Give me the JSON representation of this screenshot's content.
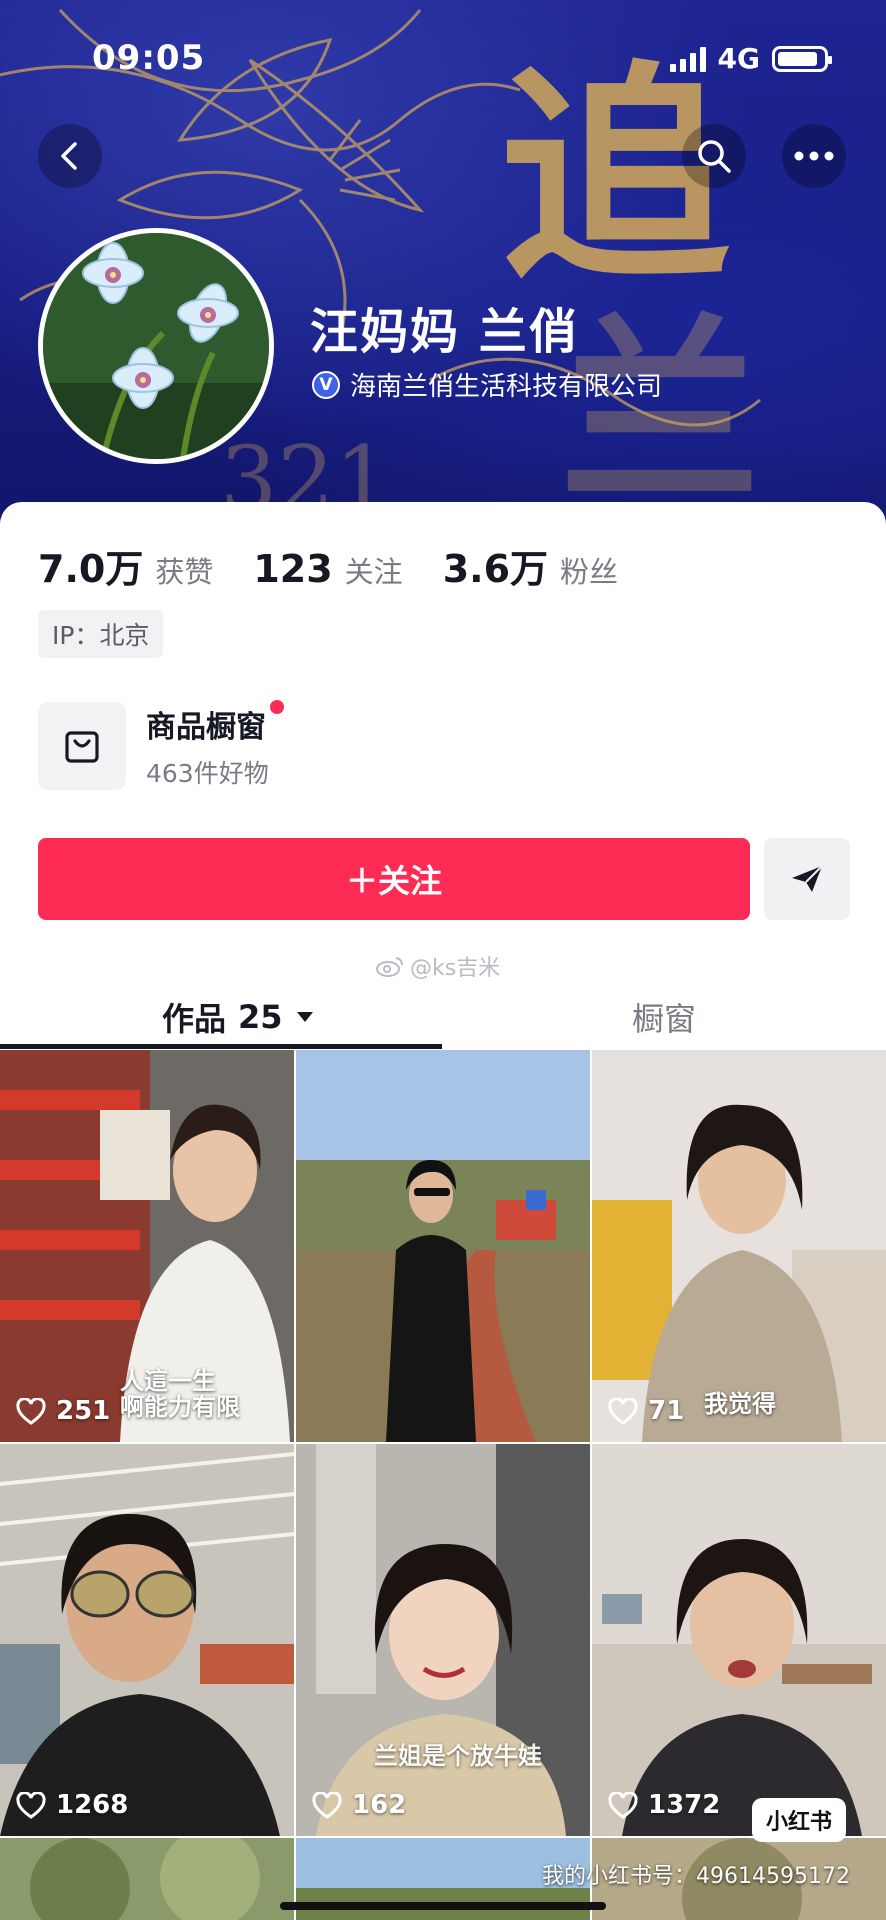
{
  "status_bar": {
    "time": "09:05",
    "network": "4G"
  },
  "banner": {
    "chars": [
      "追",
      "兰"
    ]
  },
  "profile": {
    "name": "汪妈妈 兰俏",
    "verified_badge": "V",
    "company": "海南兰俏生活科技有限公司"
  },
  "stats": [
    {
      "num": "7.0万",
      "label": "获赞"
    },
    {
      "num": "123",
      "label": "关注"
    },
    {
      "num": "3.6万",
      "label": "粉丝"
    }
  ],
  "ip_tag": "IP：北京",
  "shop": {
    "title": "商品橱窗",
    "subtitle": "463件好物"
  },
  "follow_button": "＋关注",
  "mid_watermark": "@ks吉米",
  "tabs": {
    "works_label": "作品",
    "works_count": "25",
    "shop_label": "橱窗"
  },
  "videos": [
    {
      "likes": "251",
      "caption": "人這一生\n啊能力有限"
    },
    {
      "likes": "",
      "caption": ""
    },
    {
      "likes": "71",
      "caption": "我觉得"
    },
    {
      "likes": "1268",
      "caption": ""
    },
    {
      "likes": "162",
      "caption": "兰姐是个放牛娃"
    },
    {
      "likes": "1372",
      "caption": ""
    }
  ],
  "overlay": {
    "xhs_badge": "小红书",
    "xhs_id": "我的小红书号：4961459517​2"
  },
  "colors": {
    "accent": "#fe2c55",
    "banner": "#1e2492",
    "gold": "#c9a25c"
  }
}
